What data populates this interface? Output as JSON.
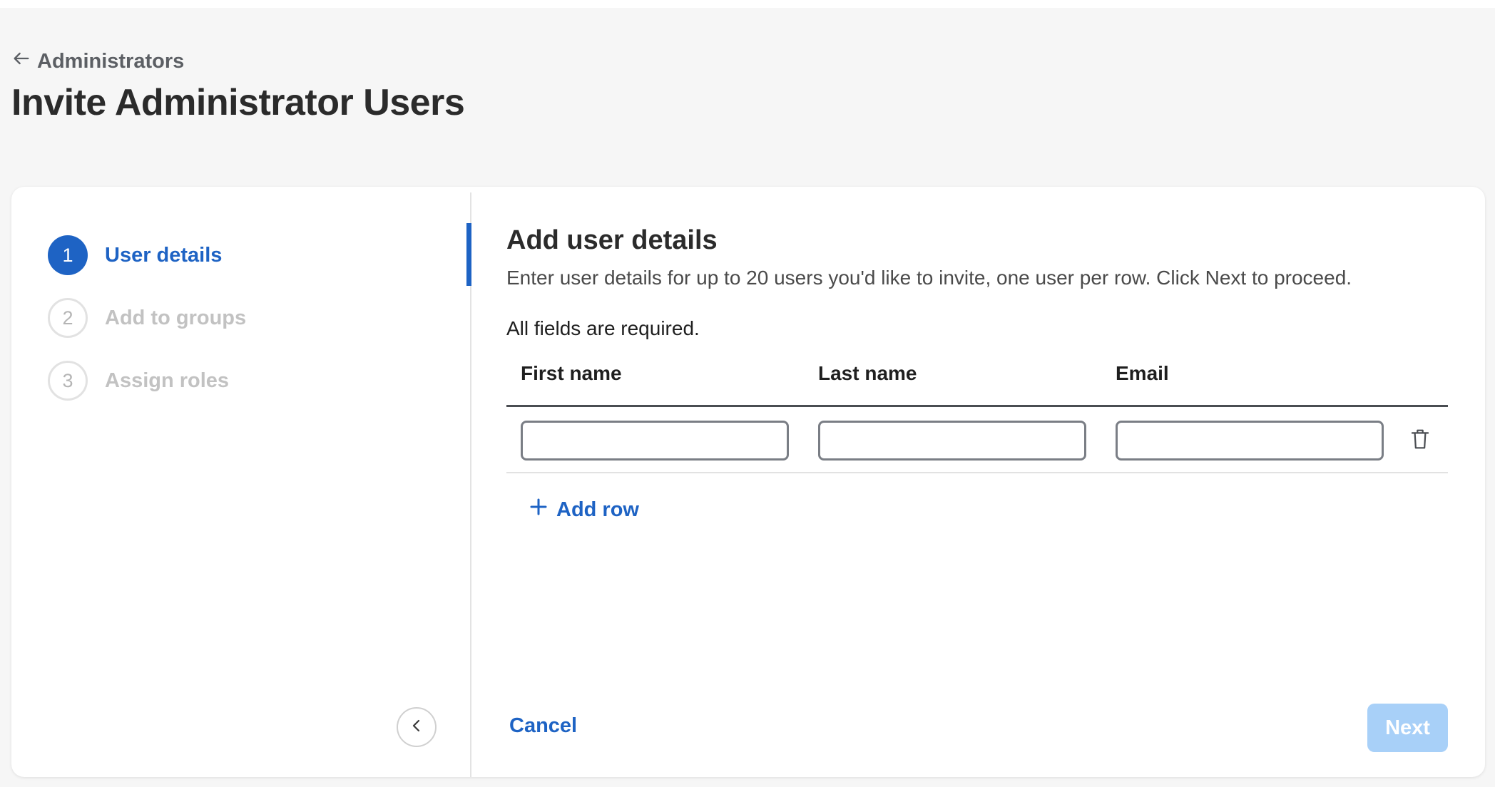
{
  "header": {
    "back_label": "Administrators",
    "title": "Invite Administrator Users"
  },
  "steps": [
    {
      "number": "1",
      "label": "User details",
      "state": "active"
    },
    {
      "number": "2",
      "label": "Add to groups",
      "state": "inactive"
    },
    {
      "number": "3",
      "label": "Assign roles",
      "state": "inactive"
    }
  ],
  "main": {
    "title": "Add user details",
    "description": "Enter user details for up to 20 users you'd like to invite, one user per row. Click Next to proceed.",
    "required_note": "All fields are required.",
    "columns": [
      "First name",
      "Last name",
      "Email"
    ],
    "rows": [
      {
        "first_name": "",
        "last_name": "",
        "email": ""
      }
    ],
    "add_row_label": "Add row"
  },
  "footer": {
    "cancel_label": "Cancel",
    "next_label": "Next",
    "next_disabled": true
  },
  "icons": {
    "back": "arrow-left-icon",
    "collapse": "chevron-left-icon",
    "add": "plus-icon",
    "delete": "trash-icon"
  },
  "colors": {
    "accent": "#1e63c4",
    "disabled_button": "#a8d0f8",
    "background": "#f6f6f6"
  }
}
